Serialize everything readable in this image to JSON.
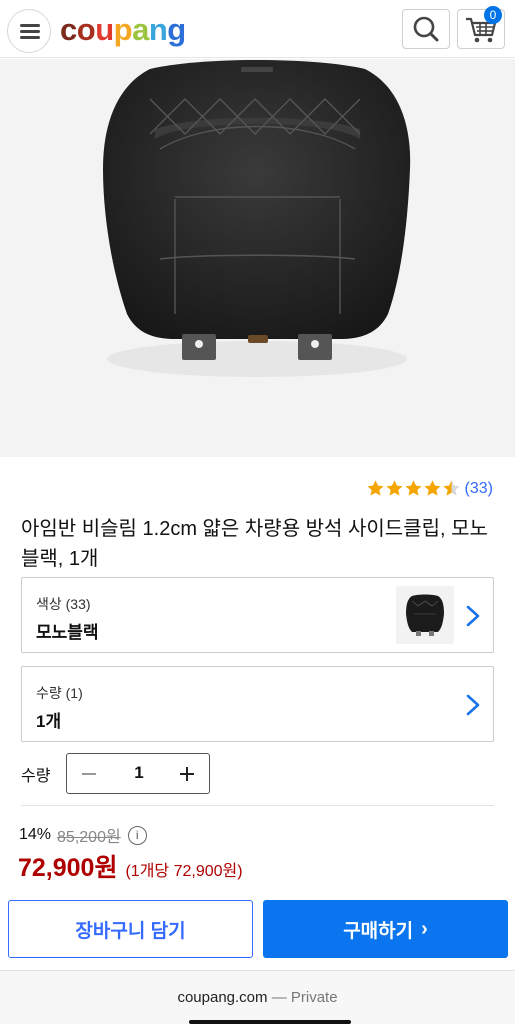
{
  "header": {
    "logo_letters": [
      "c",
      "o",
      "u",
      "p",
      "a",
      "n",
      "g"
    ],
    "logo_colors": [
      "#7b2a1c",
      "#a6301f",
      "#e03a2e",
      "#f5a623",
      "#9bc43f",
      "#3aa4dc",
      "#2c6fd6"
    ],
    "cart_count": "0",
    "icons": {
      "menu": "menu-icon",
      "search": "search-icon",
      "cart": "cart-icon"
    }
  },
  "product": {
    "rating_value": 4.5,
    "review_count": "(33)",
    "title": "아임반 비슬림 1.2cm 얇은 차량용 방석 사이드클립, 모노블랙, 1개"
  },
  "options": [
    {
      "label": "색상 (33)",
      "value": "모노블랙",
      "has_thumb": true
    },
    {
      "label": "수량 (1)",
      "value": "1개",
      "has_thumb": false
    }
  ],
  "quantity": {
    "label": "수량",
    "value": "1"
  },
  "pricing": {
    "discount": "14%",
    "original": "85,200원",
    "price": "72,900원",
    "unit_price": "(1개당 72,900원)"
  },
  "actions": {
    "add_to_cart": "장바구니 담기",
    "buy_now": "구매하기",
    "buy_arrow": "›"
  },
  "browser": {
    "domain": "coupang.com",
    "mode": "— Private"
  },
  "colors": {
    "accent_blue": "#346aff",
    "buy_blue": "#0a75ef",
    "price_red": "#ae0000",
    "star_gold": "#f5a500"
  }
}
